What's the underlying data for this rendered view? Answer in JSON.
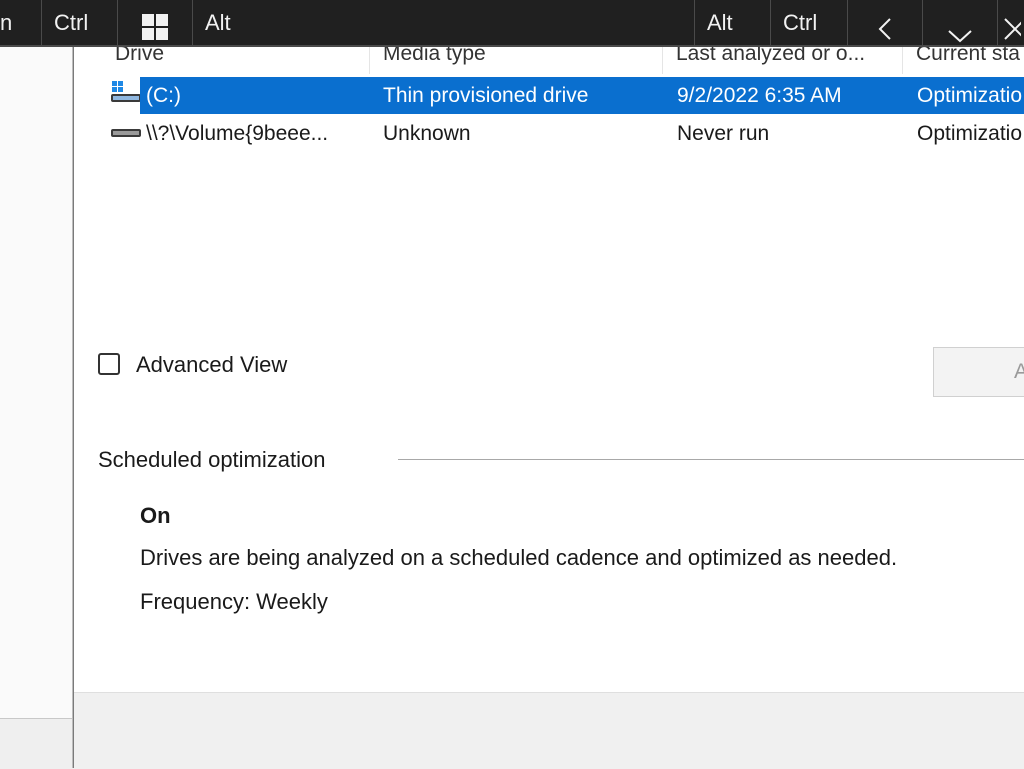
{
  "toolbar": {
    "left_partial": "n",
    "ctrl_left": "Ctrl",
    "alt_left": "Alt",
    "alt_right": "Alt",
    "ctrl_right": "Ctrl",
    "icons": [
      "windows-icon",
      "chevron-left-icon",
      "chevron-down-icon",
      "close-icon"
    ]
  },
  "drive_table": {
    "columns": [
      "Drive",
      "Media type",
      "Last analyzed or o...",
      "Current sta"
    ],
    "rows": [
      {
        "drive": "(C:)",
        "media_type": "Thin provisioned drive",
        "last_analyzed": "9/2/2022 6:35 AM",
        "current_status": "Optimizatio",
        "selected": true
      },
      {
        "drive": "\\\\?\\Volume{9beee...",
        "media_type": "Unknown",
        "last_analyzed": "Never run",
        "current_status": "Optimizatio",
        "selected": false
      }
    ]
  },
  "advanced_view": {
    "label": "Advanced View",
    "checked": false
  },
  "analyze_button": {
    "label": "A"
  },
  "scheduled": {
    "title": "Scheduled optimization",
    "status": "On",
    "description": "Drives are being analyzed on a scheduled cadence and optimized as needed.",
    "frequency": "Frequency: Weekly"
  },
  "colors": {
    "selection": "#0a6fcf",
    "toolbar_bg": "#202020"
  }
}
